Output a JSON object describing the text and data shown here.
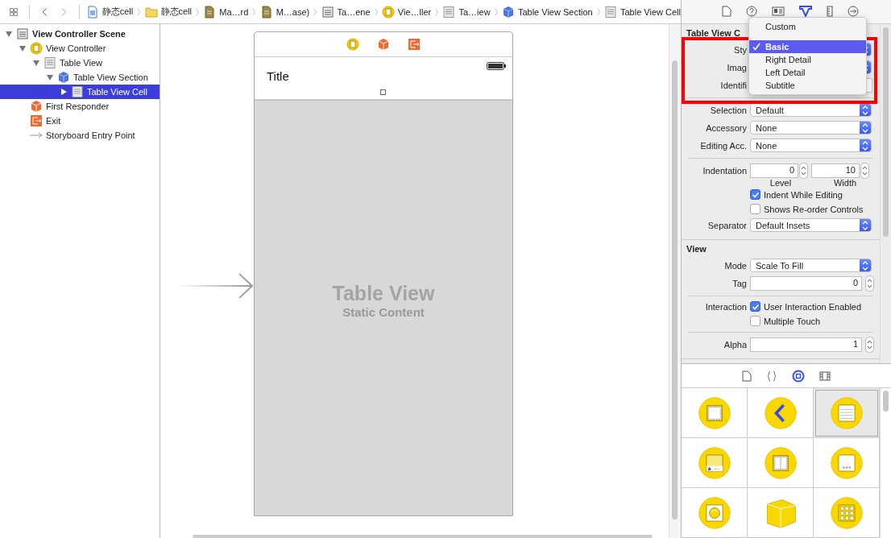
{
  "breadcrumb": [
    {
      "label": "静态cell",
      "kind": "project"
    },
    {
      "label": "静态cell",
      "kind": "folder"
    },
    {
      "label": "Ma…rd",
      "kind": "storyboard"
    },
    {
      "label": "M…ase)",
      "kind": "storyboard"
    },
    {
      "label": "Ta…ene",
      "kind": "scene"
    },
    {
      "label": "Vie…ller",
      "kind": "controller"
    },
    {
      "label": "Ta…iew",
      "kind": "table"
    },
    {
      "label": "Table View Section",
      "kind": "section"
    },
    {
      "label": "Table View Cell",
      "kind": "table"
    }
  ],
  "outline": [
    {
      "label": "View Controller Scene",
      "kind": "scene",
      "expanded": true,
      "selected": false,
      "children": [
        {
          "label": "View Controller",
          "kind": "controller",
          "expanded": true,
          "selected": false,
          "children": [
            {
              "label": "Table View",
              "kind": "table",
              "expanded": true,
              "selected": false,
              "children": [
                {
                  "label": "Table View Section",
                  "kind": "section",
                  "expanded": true,
                  "selected": false,
                  "children": [
                    {
                      "label": "Table View Cell",
                      "kind": "table",
                      "expanded": false,
                      "selected": true
                    }
                  ]
                }
              ]
            }
          ]
        },
        {
          "label": "First Responder",
          "kind": "responder",
          "selected": false
        },
        {
          "label": "Exit",
          "kind": "exit",
          "selected": false
        },
        {
          "label": "Storyboard Entry Point",
          "kind": "arrow",
          "selected": false
        }
      ]
    }
  ],
  "canvas": {
    "cell_title": "Title",
    "placeholder_title": "Table View",
    "placeholder_subtitle": "Static Content"
  },
  "inspector": {
    "sections": [
      {
        "title": "Table View C",
        "rows": [
          {
            "kind": "popup",
            "label": "Sty"
          },
          {
            "kind": "popup",
            "label": "Imag"
          },
          {
            "kind": "text",
            "label": "Identifi"
          },
          {
            "kind": "divider"
          },
          {
            "kind": "popup",
            "label": "Selection",
            "value": "Default"
          },
          {
            "kind": "popup",
            "label": "Accessory",
            "value": "None"
          },
          {
            "kind": "popup",
            "label": "Editing Acc.",
            "value": "None"
          },
          {
            "kind": "divider"
          },
          {
            "kind": "pair",
            "label": "Indentation",
            "fields": [
              {
                "value": "0",
                "caption": "Level"
              },
              {
                "value": "10",
                "caption": "Width"
              }
            ]
          },
          {
            "kind": "checkbox",
            "text": "Indent While Editing",
            "checked": true
          },
          {
            "kind": "checkbox",
            "text": "Shows Re-order Controls",
            "checked": false
          },
          {
            "kind": "popup",
            "label": "Separator",
            "value": "Default Insets"
          }
        ]
      },
      {
        "title": "View",
        "rows": [
          {
            "kind": "popup",
            "label": "Mode",
            "value": "Scale To Fill"
          },
          {
            "kind": "stepper",
            "label": "Tag",
            "value": "0"
          },
          {
            "kind": "divider"
          },
          {
            "kind": "checkbox",
            "label": "Interaction",
            "text": "User Interaction Enabled",
            "checked": true
          },
          {
            "kind": "checkbox",
            "text": "Multiple Touch",
            "checked": false
          },
          {
            "kind": "divider"
          },
          {
            "kind": "stepper",
            "label": "Alpha",
            "value": "1"
          }
        ]
      }
    ]
  },
  "style_menu": {
    "items": [
      {
        "label": "Custom",
        "selected": false
      },
      {
        "label": "Basic",
        "selected": true
      },
      {
        "label": "Right Detail",
        "selected": false
      },
      {
        "label": "Left Detail",
        "selected": false
      },
      {
        "label": "Subtitle",
        "selected": false
      }
    ]
  },
  "library": {
    "items": [
      {
        "kind": "frame",
        "selected": false
      },
      {
        "kind": "back",
        "selected": false
      },
      {
        "kind": "lines",
        "selected": true
      },
      {
        "kind": "card",
        "selected": false
      },
      {
        "kind": "split",
        "selected": false
      },
      {
        "kind": "dots",
        "selected": false
      },
      {
        "kind": "button",
        "selected": false
      },
      {
        "kind": "cube",
        "selected": false
      },
      {
        "kind": "grid",
        "selected": false
      }
    ]
  }
}
